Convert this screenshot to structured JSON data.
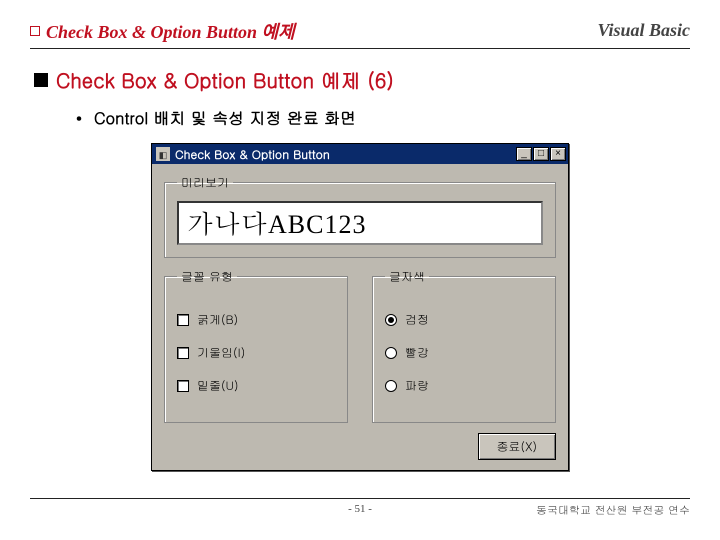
{
  "header": {
    "breadcrumb": "Check Box & Option Button 예제",
    "brand": "Visual Basic"
  },
  "section": {
    "title": "Check Box & Option Button 예제 (6)",
    "bullet": "Control 배치 및 속성 지정 완료 화면"
  },
  "vbwin": {
    "title": "Check Box & Option Button",
    "preview_legend": "미리보기",
    "preview_text": "가나다ABC123",
    "font_group": "글꼴 유형",
    "color_group": "글자색",
    "checks": [
      {
        "label": "굵게(B)"
      },
      {
        "label": "기울임(I)"
      },
      {
        "label": "밑줄(U)"
      }
    ],
    "radios": [
      {
        "label": "검정",
        "selected": true
      },
      {
        "label": "빨강",
        "selected": false
      },
      {
        "label": "파랑",
        "selected": false
      }
    ],
    "exit_label": "종료(X)"
  },
  "footer": {
    "page": "- 51 -",
    "org": "동국대학교 전산원 부전공 연수"
  }
}
